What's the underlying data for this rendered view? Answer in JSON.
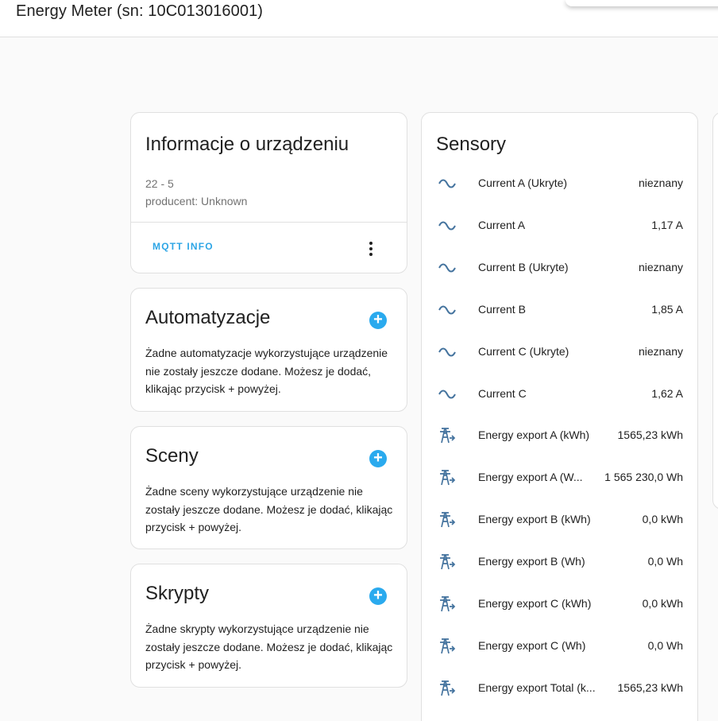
{
  "header": {
    "title": "Energy Meter (sn: 10C013016001)"
  },
  "device_info": {
    "title": "Informacje o urządzeniu",
    "model": "22 - 5",
    "manufacturer": "producent: Unknown",
    "mqtt_button": "MQTT INFO"
  },
  "automations": {
    "title": "Automatyzacje",
    "description": "Żadne automatyzacje wykorzystujące urządzenie nie zostały jeszcze dodane. Możesz je dodać, klikając przycisk + powyżej."
  },
  "scenes": {
    "title": "Sceny",
    "description": "Żadne sceny wykorzystujące urządzenie nie zostały jeszcze dodane. Możesz je dodać, klikając przycisk + powyżej."
  },
  "scripts": {
    "title": "Skrypty",
    "description": "Żadne skrypty wykorzystujące urządzenie nie zostały jeszcze dodane. Możesz je dodać, klikając przycisk + powyżej."
  },
  "sensors": {
    "title": "Sensory",
    "items": [
      {
        "icon": "sine-wave-icon",
        "name": "Current A (Ukryte)",
        "value": "nieznany"
      },
      {
        "icon": "sine-wave-icon",
        "name": "Current A",
        "value": "1,17 A"
      },
      {
        "icon": "sine-wave-icon",
        "name": "Current B (Ukryte)",
        "value": "nieznany"
      },
      {
        "icon": "sine-wave-icon",
        "name": "Current B",
        "value": "1,85 A"
      },
      {
        "icon": "sine-wave-icon",
        "name": "Current C (Ukryte)",
        "value": "nieznany"
      },
      {
        "icon": "sine-wave-icon",
        "name": "Current C",
        "value": "1,62 A"
      },
      {
        "icon": "transmission-tower-export-icon",
        "name": "Energy export A (kWh)",
        "value": "1565,23 kWh"
      },
      {
        "icon": "transmission-tower-export-icon",
        "name": "Energy export A (W...",
        "value": "1 565 230,0 Wh"
      },
      {
        "icon": "transmission-tower-export-icon",
        "name": "Energy export B (kWh)",
        "value": "0,0 kWh"
      },
      {
        "icon": "transmission-tower-export-icon",
        "name": "Energy export B (Wh)",
        "value": "0,0 Wh"
      },
      {
        "icon": "transmission-tower-export-icon",
        "name": "Energy export C (kWh)",
        "value": "0,0 kWh"
      },
      {
        "icon": "transmission-tower-export-icon",
        "name": "Energy export C (Wh)",
        "value": "0,0 Wh"
      },
      {
        "icon": "transmission-tower-export-icon",
        "name": "Energy export Total (k...",
        "value": "1565,23 kWh"
      }
    ]
  },
  "colors": {
    "accent": "#2aaaee",
    "icon": "#44739e",
    "link": "#2ea6e6"
  }
}
